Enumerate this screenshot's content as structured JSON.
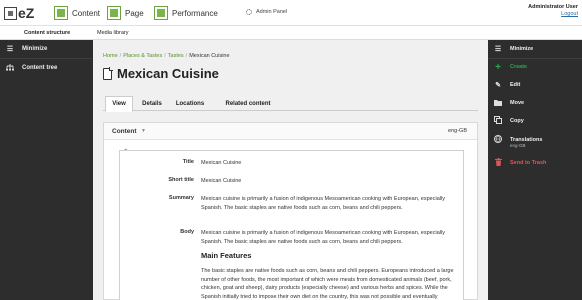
{
  "app": {
    "logo_text": "eZ",
    "tabs": [
      {
        "label": "Content"
      },
      {
        "label": "Page"
      },
      {
        "label": "Performance"
      }
    ],
    "admin_panel": "Admin Panel",
    "user": {
      "name": "Administrator User",
      "logout": "Logout"
    }
  },
  "subnav": {
    "items": [
      "Content structure",
      "Media library"
    ]
  },
  "left_sidebar": {
    "items": [
      {
        "label": "Minimize",
        "icon": "hamburger-icon"
      },
      {
        "label": "Content tree",
        "icon": "tree-icon"
      }
    ]
  },
  "right_sidebar": {
    "items": [
      {
        "label": "Minimize",
        "icon": "hamburger-icon"
      },
      {
        "label": "Create",
        "icon": "plus-icon"
      },
      {
        "label": "Edit",
        "icon": "pencil-icon"
      },
      {
        "label": "Move",
        "icon": "folder-icon"
      },
      {
        "label": "Copy",
        "icon": "copy-icon"
      },
      {
        "label": "Translations",
        "icon": "flag-icon",
        "sub": "eng-GB"
      },
      {
        "label": "Send to Trash",
        "icon": "trash-icon"
      }
    ],
    "create_color": "#2ea84a",
    "trash_color": "#e25555"
  },
  "breadcrumb": [
    "Home",
    "Places & Tastes",
    "Tastes",
    "Mexican Cuisine"
  ],
  "page_title": "Mexican Cuisine",
  "view_tabs": [
    "View",
    "Details",
    "Locations",
    "Related content"
  ],
  "content_panel": {
    "label": "Content",
    "language": "eng-GB",
    "fields": {
      "title": {
        "label": "Title",
        "value": "Mexican Cuisine"
      },
      "short_title": {
        "label": "Short title",
        "value": "Mexican Cuisine"
      },
      "summary": {
        "label": "Summary",
        "value": "Mexican cuisine is primarily a fusion of indigenous Mesoamerican cooking with European, especially Spanish. The basic staples are native foods such as corn, beans and chili peppers."
      },
      "body": {
        "label": "Body",
        "intro": "Mexican cuisine is primarily a fusion of indigenous Mesoamerican cooking with European, especially Spanish. The basic staples are native foods such as corn, beans and chili peppers.",
        "heading": "Main Features",
        "paragraph": "The basic staples are native foods such as corn, beans and chili peppers. Europeans introduced a large number of other foods, the most important of which were meats from domesticated animals (beef, pork, chicken, goat and sheep), dairy products (especially cheese) and various herbs and spices. While the Spanish initially tried to impose their own diet on the country, this was not possible and eventually"
      }
    }
  }
}
